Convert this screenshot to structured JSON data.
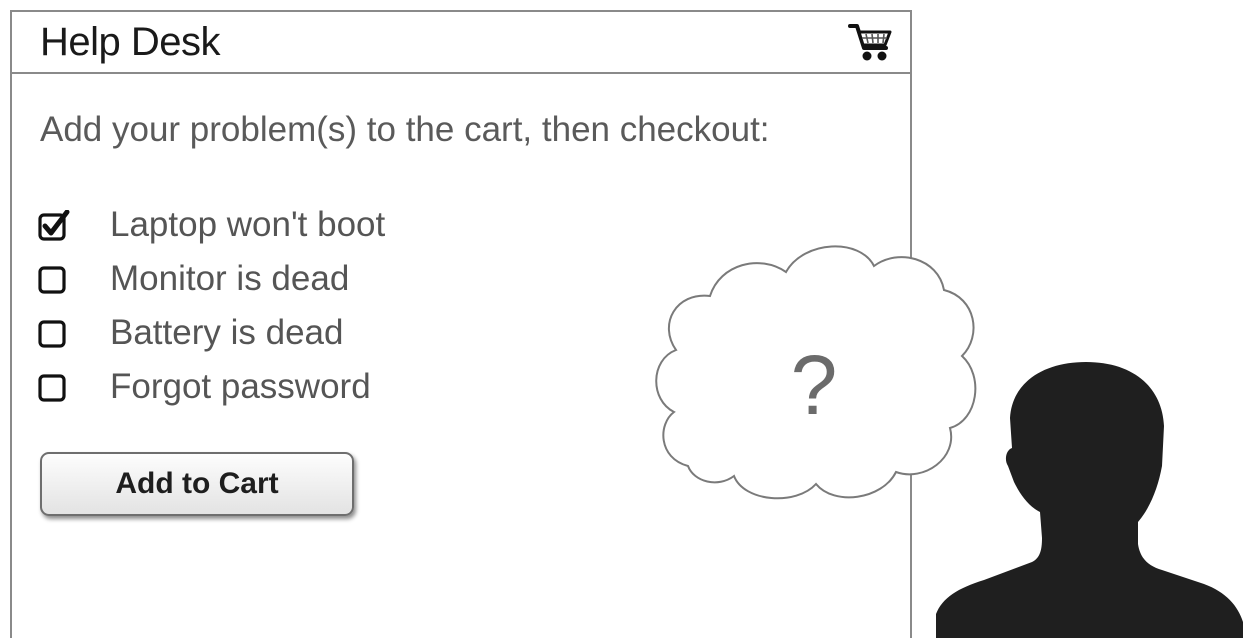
{
  "app": {
    "title": "Help Desk",
    "cart_icon": "shopping-cart-icon"
  },
  "instructions": "Add your problem(s) to the cart, then checkout:",
  "problems": [
    {
      "label": "Laptop won't boot",
      "checked": true
    },
    {
      "label": "Monitor is dead",
      "checked": false
    },
    {
      "label": "Battery is dead",
      "checked": false
    },
    {
      "label": "Forgot password",
      "checked": false
    }
  ],
  "actions": {
    "add_to_cart_label": "Add to Cart"
  },
  "thought": {
    "symbol": "?"
  },
  "illustration": {
    "person_icon": "person-silhouette-icon"
  }
}
